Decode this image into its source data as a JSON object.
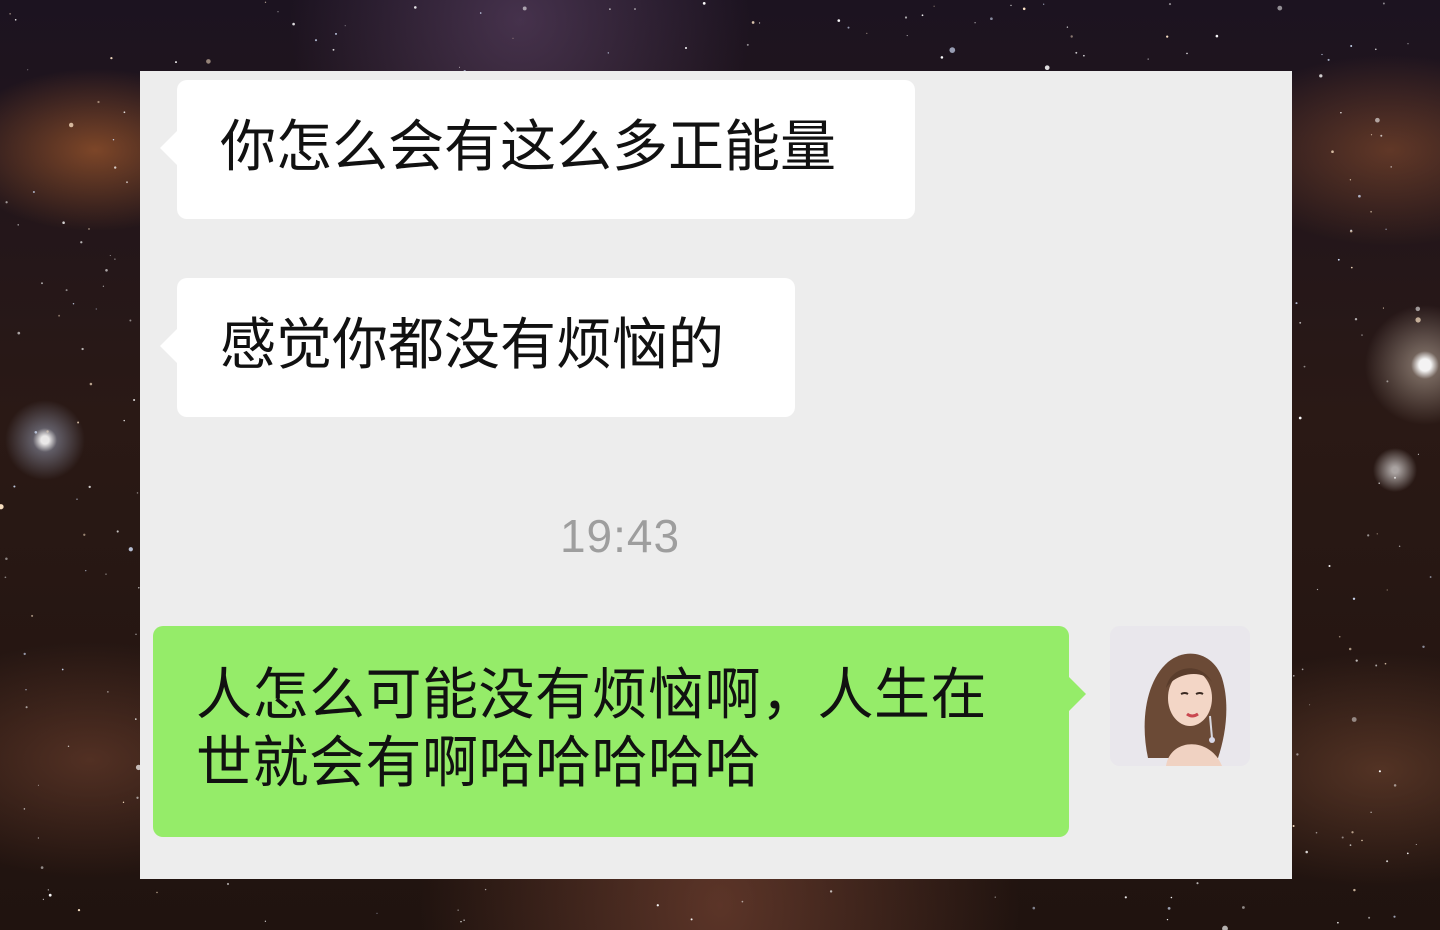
{
  "chat": {
    "messages": [
      {
        "direction": "incoming",
        "text": "你怎么会有这么多正能量"
      },
      {
        "direction": "incoming",
        "text": "感觉你都没有烦恼的"
      },
      {
        "direction": "outgoing",
        "text": "人怎么可能没有烦恼啊，人生在世就会有啊哈哈哈哈哈"
      }
    ],
    "timestamp": "19:43"
  },
  "colors": {
    "panel_background": "#ededed",
    "incoming_bubble": "#ffffff",
    "outgoing_bubble": "#95ec69",
    "timestamp_text": "#9e9e9e",
    "message_text": "#111111"
  },
  "icons": {
    "avatar": "user-avatar-photo",
    "background": "starry-night-sky"
  }
}
